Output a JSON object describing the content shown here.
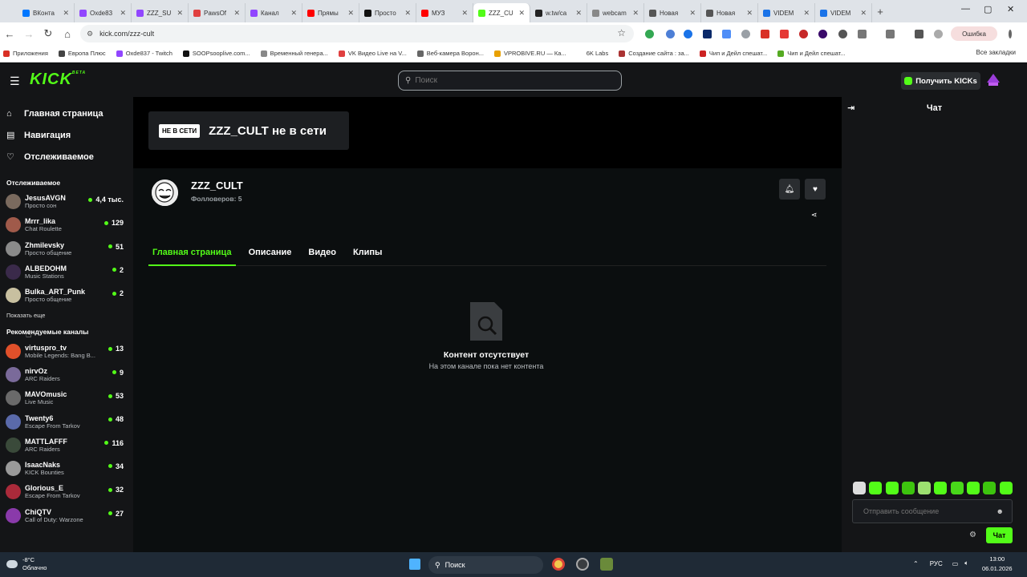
{
  "browser": {
    "tabs": [
      {
        "title": "ВКонта",
        "color": "#0077ff"
      },
      {
        "title": "Oxde83",
        "color": "#9146ff"
      },
      {
        "title": "ZZZ_SU",
        "color": "#9146ff"
      },
      {
        "title": "PawsOf",
        "color": "#e04040"
      },
      {
        "title": "Канал",
        "color": "#9146ff"
      },
      {
        "title": "Прямы",
        "color": "#ff0000"
      },
      {
        "title": "Просто",
        "color": "#111111"
      },
      {
        "title": "МУЗ",
        "color": "#ff0000"
      },
      {
        "title": "ZZZ_CU",
        "color": "#53fc18",
        "active": true
      },
      {
        "title": "w.tw/ca",
        "color": "#222222"
      },
      {
        "title": "webcam",
        "color": "#888888"
      },
      {
        "title": "Новая",
        "color": "#555555"
      },
      {
        "title": "Новая",
        "color": "#555555"
      },
      {
        "title": "VIDEM",
        "color": "#1a73e8"
      },
      {
        "title": "VIDEM",
        "color": "#1a73e8"
      }
    ],
    "url": "kick.com/zzz-cult",
    "error_label": "Ошибка",
    "bookmarks": [
      {
        "label": "Приложения",
        "color": "#d93025"
      },
      {
        "label": "Европа Плюс",
        "color": "#444444"
      },
      {
        "label": "Oxde837 - Twitch",
        "color": "#9146ff"
      },
      {
        "label": "SOOPsooplive.com...",
        "color": "#111111"
      },
      {
        "label": "Временный генера...",
        "color": "#888888"
      },
      {
        "label": "VK Видео Live на V...",
        "color": "#e04040"
      },
      {
        "label": "Веб-камера Ворон...",
        "color": "#666666"
      },
      {
        "label": "VPROBIVE.RU — Ка...",
        "color": "#e8a000"
      },
      {
        "label": "6K Labs",
        "color": "#ffffff"
      },
      {
        "label": "Создание сайта : за...",
        "color": "#aa3333"
      },
      {
        "label": "Чип и Дейл спешат...",
        "color": "#cc2222"
      },
      {
        "label": "Чип и Дейл спешат...",
        "color": "#55aa22"
      }
    ],
    "all_bookmarks_label": "Все закладки"
  },
  "header": {
    "logo": "KICK",
    "logo_tag": "BETA",
    "search_placeholder": "Поиск",
    "get_kicks_label": "Получить KICKs"
  },
  "sidebar": {
    "nav": [
      {
        "label": "Главная страница",
        "icon": "home-icon",
        "glyph": "⌂"
      },
      {
        "label": "Навигация",
        "icon": "browse-icon",
        "glyph": "▤"
      },
      {
        "label": "Отслеживаемое",
        "icon": "heart-icon",
        "glyph": "♡"
      }
    ],
    "following_title": "Отслеживаемое",
    "following": [
      {
        "name": "JesusAVGN",
        "sub": "Просто сон",
        "viewers": "4,4 тыс.",
        "color": "#7a6a5e"
      },
      {
        "name": "Mrrr_lika",
        "sub": "Chat Roulette",
        "viewers": "129",
        "color": "#a05a4a"
      },
      {
        "name": "Zhmilevsky",
        "sub": "Просто общение",
        "viewers": "51",
        "color": "#8a8a8a"
      },
      {
        "name": "ALBEDOHM",
        "sub": "Music Stations",
        "viewers": "2",
        "color": "#3a2a4a"
      },
      {
        "name": "Bulka_ART_Punk",
        "sub": "Просто общение",
        "viewers": "2",
        "color": "#c8c0a0"
      }
    ],
    "show_more": "Показать еще",
    "recommended_title": "Рекомендуемые каналы",
    "recommended": [
      {
        "name": "virtuspro_tv",
        "sub": "Mobile Legends: Bang B...",
        "viewers": "13",
        "color": "#e0502a"
      },
      {
        "name": "nirvOz",
        "sub": "ARC Raiders",
        "viewers": "9",
        "color": "#7a6a9a"
      },
      {
        "name": "MAVOmusic",
        "sub": "Live Music",
        "viewers": "53",
        "color": "#6a6a6a"
      },
      {
        "name": "Twenty6",
        "sub": "Escape From Tarkov",
        "viewers": "48",
        "color": "#5a6aaa"
      },
      {
        "name": "MATTLAFFF",
        "sub": "ARC Raiders",
        "viewers": "116",
        "color": "#3a4a3a"
      },
      {
        "name": "IsaacNaks",
        "sub": "KICK Bounties",
        "viewers": "34",
        "color": "#9a9a9a"
      },
      {
        "name": "Glorious_E",
        "sub": "Escape From Tarkov",
        "viewers": "32",
        "color": "#aa2a3a"
      },
      {
        "name": "ChiQTV",
        "sub": "Call of Duty: Warzone",
        "viewers": "27",
        "color": "#8a3aaa"
      }
    ]
  },
  "channel": {
    "offline_badge": "НЕ В СЕТИ",
    "offline_text": "ZZZ_CULT не в сети",
    "name": "ZZZ_CULT",
    "followers": "Фолловеров: 5",
    "tabs": [
      "Главная страница",
      "Описание",
      "Видео",
      "Клипы"
    ],
    "empty_title": "Контент отсутствует",
    "empty_sub": "На этом канале пока нет контента"
  },
  "chat": {
    "title": "Чат",
    "placeholder": "Отправить сообщение",
    "send_label": "Чат"
  },
  "taskbar": {
    "temp": "-8°C",
    "weather": "Облачно",
    "search": "Поиск",
    "lang": "РУС",
    "time": "13:00",
    "date": "06.01.2026"
  }
}
